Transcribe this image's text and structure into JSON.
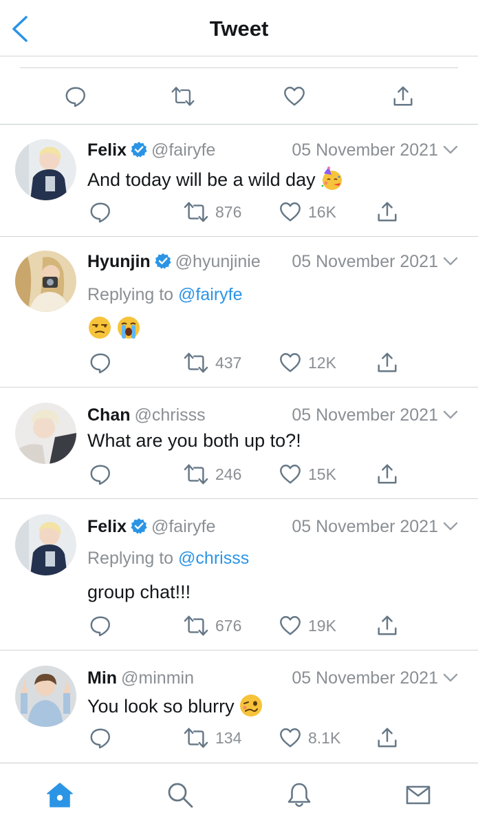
{
  "header": {
    "title": "Tweet"
  },
  "colors": {
    "accent": "#2b94e5",
    "secondary_text": "#8a8f94",
    "icon_gray": "#657786",
    "divider": "#d0d4d8"
  },
  "tweets": [
    {
      "name": "Felix",
      "verified": true,
      "handle": "@fairyfe",
      "date": "05 November 2021",
      "reply_label": "",
      "reply_to": "",
      "text": "And today will be a wild day",
      "emojis": [
        "partying-face-emoji"
      ],
      "retweets": "876",
      "likes": "16K"
    },
    {
      "name": "Hyunjin",
      "verified": true,
      "handle": "@hyunjinie",
      "date": "05 November 2021",
      "reply_label": "Replying to",
      "reply_to": "@fairyfe",
      "text": "",
      "emojis": [
        "unamused-face-emoji",
        "loudly-crying-face-emoji"
      ],
      "retweets": "437",
      "likes": "12K"
    },
    {
      "name": "Chan",
      "verified": false,
      "handle": "@chrisss",
      "date": "05 November 2021",
      "reply_label": "",
      "reply_to": "",
      "text": "What are you both up to?!",
      "emojis": [],
      "retweets": "246",
      "likes": "15K"
    },
    {
      "name": "Felix",
      "verified": true,
      "handle": "@fairyfe",
      "date": "05 November 2021",
      "reply_label": "Replying to",
      "reply_to": "@chrisss",
      "text": "group chat!!!",
      "emojis": [],
      "retweets": "676",
      "likes": "19K"
    },
    {
      "name": "Min",
      "verified": false,
      "handle": "@minmin",
      "date": "05 November 2021",
      "reply_label": "",
      "reply_to": "",
      "text": "You look so blurry",
      "emojis": [
        "woozy-face-emoji"
      ],
      "retweets": "134",
      "likes": "8.1K"
    }
  ],
  "tabbar": {
    "items": [
      "home-icon",
      "search-icon",
      "notifications-bell-icon",
      "messages-mail-icon"
    ],
    "active": "home-icon"
  }
}
